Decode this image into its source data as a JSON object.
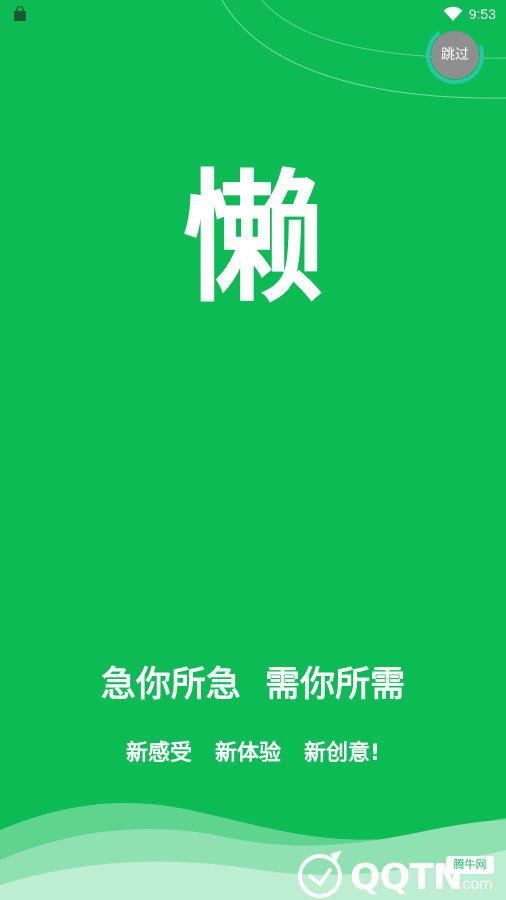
{
  "status_bar": {
    "time": "9:53",
    "left_icon": "shopping-bag-icon",
    "wifi_icon": "wifi-icon"
  },
  "skip": {
    "label": "跳过",
    "ring_color": "#26c6a8",
    "button_color": "#8f8f8f"
  },
  "splash": {
    "logo_char": "懒",
    "slogan_main": "急你所急  需你所需",
    "slogan_sub": "新感受   新体验   新创意!",
    "background_color": "#0dbb55"
  },
  "watermark": {
    "brand": "QQTN",
    "domain_suffix": ".com",
    "cn_label": "腾牛网",
    "logo_icon": "qqtn-logo-icon"
  }
}
